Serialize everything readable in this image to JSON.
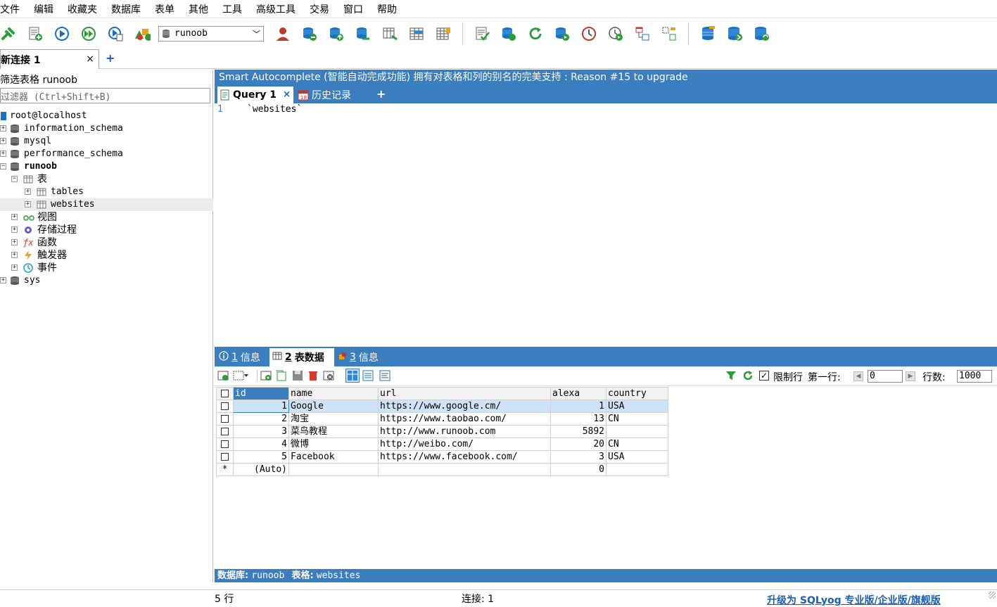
{
  "menu": [
    "文件",
    "编辑",
    "收藏夹",
    "数据库",
    "表单",
    "其他",
    "工具",
    "高级工具",
    "交易",
    "窗口",
    "帮助"
  ],
  "toolbar": {
    "db_selected": "runoob",
    "icons": [
      "new-connection-icon",
      "new-query-icon",
      "execute-icon",
      "execute-all-icon",
      "execute-edit-icon",
      "schema-designer-icon",
      "user-manager-icon",
      "db-copy-icon",
      "db-import-icon",
      "db-export-icon",
      "table-diff-icon",
      "table-structure-icon",
      "table-data-icon",
      "query-builder-icon",
      "sync-icon",
      "refresh-icon",
      "backup-icon",
      "schedule-icon",
      "restore-icon",
      "schema-compare-icon",
      "data-compare-icon",
      "db-sync-icon",
      "db-migrate-icon",
      "db-replicate-icon"
    ]
  },
  "connection_tab": {
    "label": "新连接 1",
    "close": "×",
    "add": "+"
  },
  "filter": {
    "label": "筛选表格 runoob",
    "placeholder": "过滤器 (Ctrl+Shift+B)"
  },
  "tree": {
    "host": "root@localhost",
    "databases": [
      {
        "name": "information_schema"
      },
      {
        "name": "mysql"
      },
      {
        "name": "performance_schema"
      },
      {
        "name": "runoob"
      }
    ],
    "tables_folder": "表",
    "tables": [
      "tables",
      "websites"
    ],
    "views": "视图",
    "procedures": "存储过程",
    "functions": "函数",
    "triggers": "触发器",
    "events": "事件",
    "sys": "sys"
  },
  "promo": "Smart Autocomplete (智能自动完成功能) 拥有对表格和列的别名的完美支持 : Reason #15 to upgrade",
  "query_tabs": {
    "active": "Query 1",
    "close": "×",
    "history": "历史记录",
    "add": "+"
  },
  "editor": {
    "line": "1",
    "code": "`websites`"
  },
  "result_tabs": [
    {
      "num": "1",
      "label": "信息"
    },
    {
      "num": "2",
      "label": "表数据"
    },
    {
      "num": "3",
      "label": "信息"
    }
  ],
  "result_toolbar": {
    "limit_label": "限制行",
    "first_row_label": "第一行:",
    "first_row_value": "0",
    "row_count_label": "行数:",
    "row_count_value": "1000"
  },
  "grid": {
    "columns": [
      "id",
      "name",
      "url",
      "alexa",
      "country"
    ],
    "rows": [
      {
        "id": "1",
        "name": "Google",
        "url": "https://www.google.cm/",
        "alexa": "1",
        "country": "USA"
      },
      {
        "id": "2",
        "name": "淘宝",
        "url": "https://www.taobao.com/",
        "alexa": "13",
        "country": "CN"
      },
      {
        "id": "3",
        "name": "菜鸟教程",
        "url": "http://www.runoob.com",
        "alexa": "5892",
        "country": ""
      },
      {
        "id": "4",
        "name": "微博",
        "url": "http://weibo.com/",
        "alexa": "20",
        "country": "CN"
      },
      {
        "id": "5",
        "name": "Facebook",
        "url": "https://www.facebook.com/",
        "alexa": "3",
        "country": "USA"
      }
    ],
    "new_row": {
      "marker": "*",
      "id": "(Auto)",
      "alexa": "0"
    }
  },
  "db_status": {
    "db_label": "数据库:",
    "db": "runoob",
    "table_label": "表格:",
    "table": "websites"
  },
  "statusbar": {
    "rows": "5 行",
    "connections": "连接: 1",
    "upgrade": "升级为 SQLyog 专业版/企业版/旗舰版"
  }
}
